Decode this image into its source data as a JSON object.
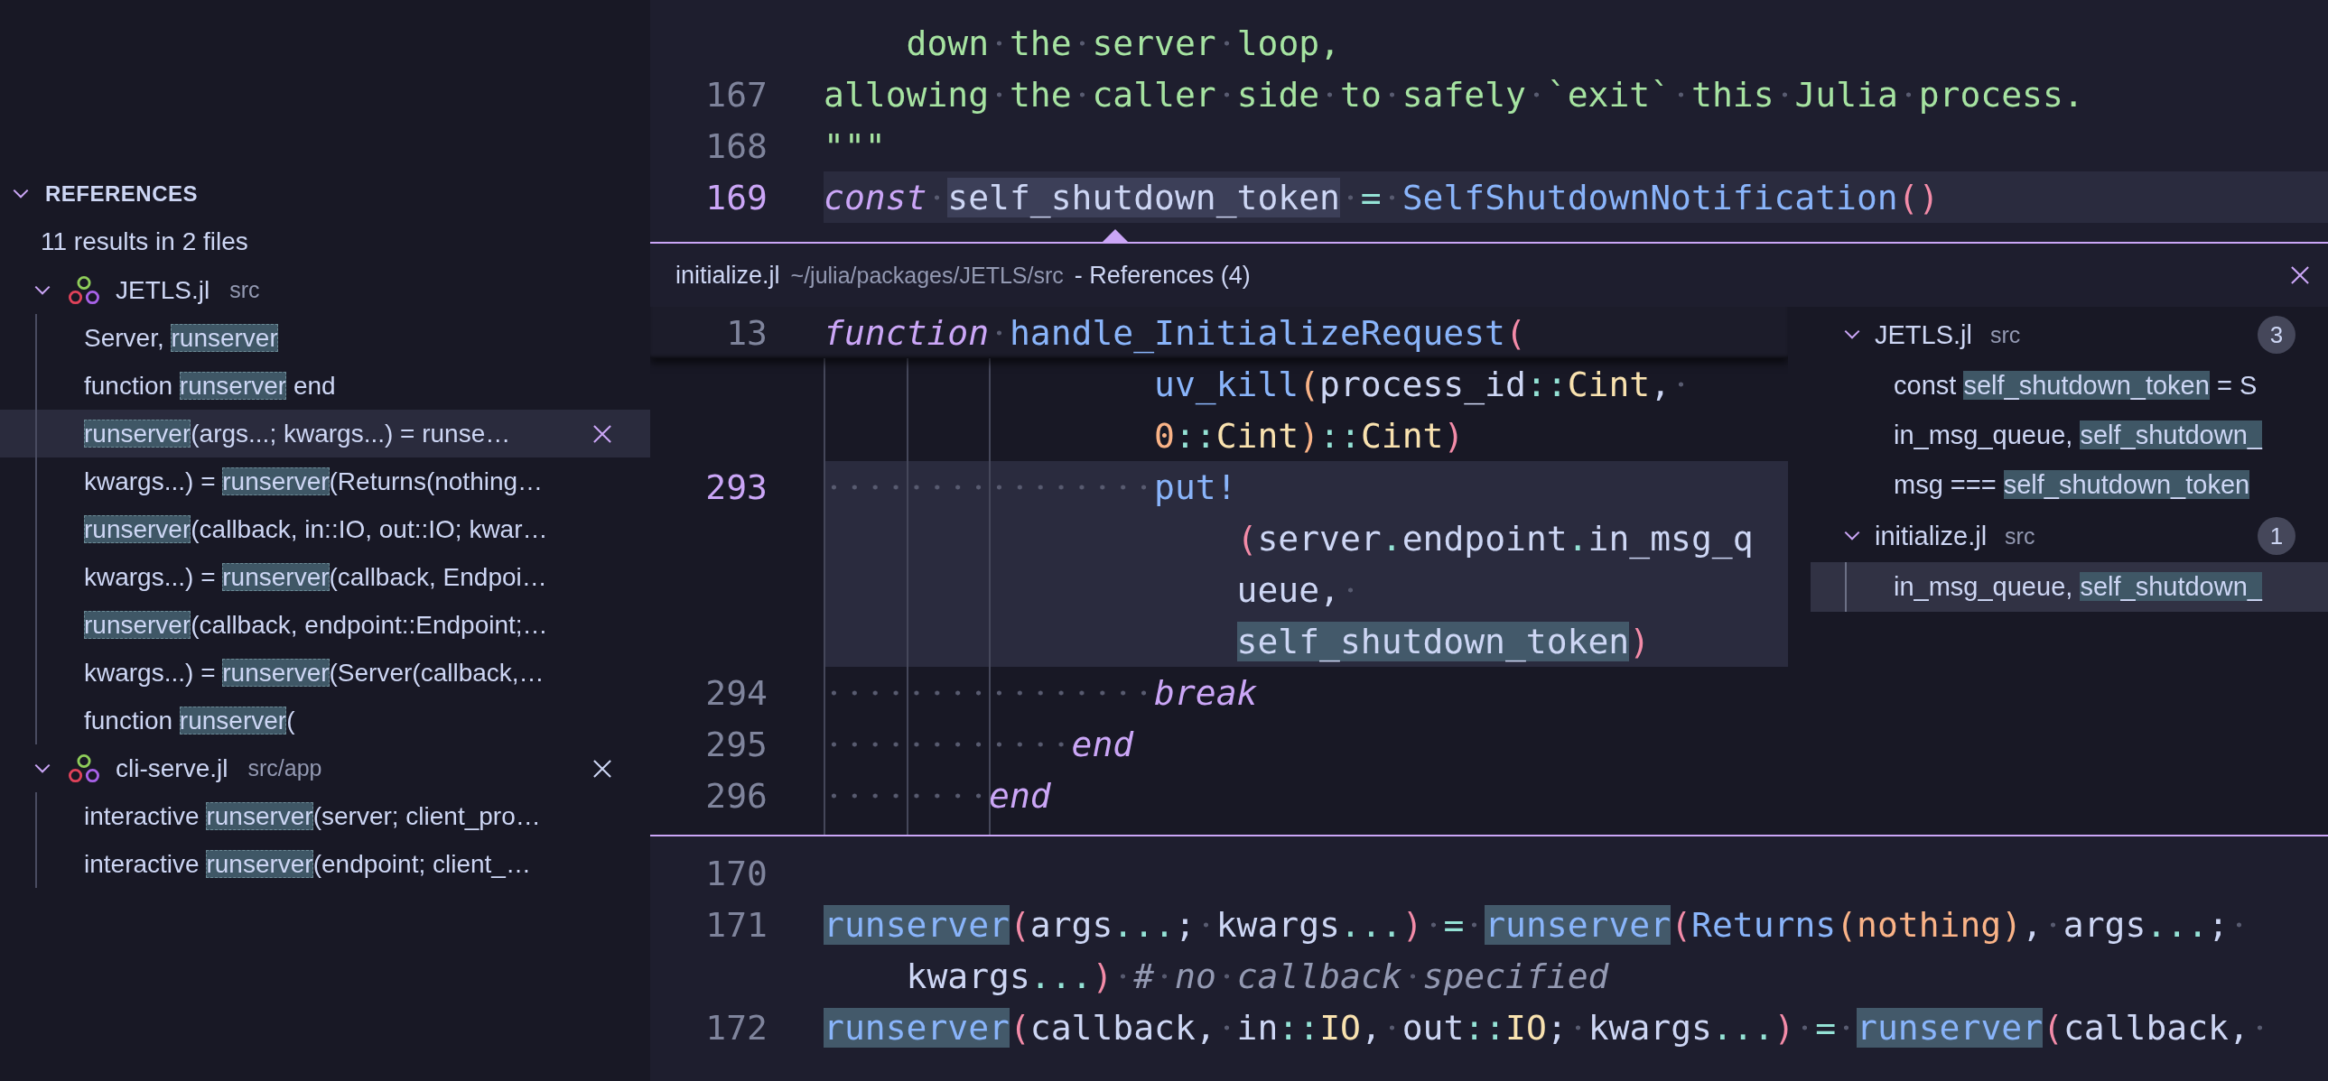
{
  "references": {
    "title": "REFERENCES",
    "expanded": true,
    "summary": "11 results in 2 files",
    "files": [
      {
        "name": "JETLS.jl",
        "path": "src",
        "expanded": true,
        "show_close": false,
        "results": [
          {
            "before": "Server, ",
            "match": "runserver",
            "selected": false
          },
          {
            "before": "function ",
            "match": "runserver",
            "after": " end",
            "selected": false
          },
          {
            "match": "runserver",
            "after": "(args...; kwargs...) = runse…",
            "selected": true
          },
          {
            "before": "kwargs...) = ",
            "match": "runserver",
            "after": "(Returns(nothing…",
            "selected": false
          },
          {
            "match": "runserver",
            "after": "(callback, in::IO, out::IO; kwar…",
            "selected": false
          },
          {
            "before": "kwargs...) = ",
            "match": "runserver",
            "after": "(callback, Endpoi…",
            "selected": false
          },
          {
            "match": "runserver",
            "after": "(callback, endpoint::Endpoint;…",
            "selected": false
          },
          {
            "before": "kwargs...) = ",
            "match": "runserver",
            "after": "(Server(callback,…",
            "selected": false
          },
          {
            "before": "function ",
            "match": "runserver",
            "after": "(",
            "selected": false
          }
        ]
      },
      {
        "name": "cli-serve.jl",
        "path": "src/app",
        "expanded": true,
        "show_close": true,
        "results": [
          {
            "before": "interactive ",
            "match": "runserver",
            "after": "(server; client_pro…",
            "selected": false
          },
          {
            "before": "interactive ",
            "match": "runserver",
            "after": "(endpoint; client_…",
            "selected": false
          }
        ]
      }
    ]
  },
  "top_editor": {
    "lines": [
      {
        "current": false,
        "rows": [
          {
            "spans": [
              {
                "kind": "str",
                "text": "    down the server loop,"
              }
            ]
          }
        ]
      },
      {
        "number": "167",
        "current": false,
        "rows": [
          {
            "spans": [
              {
                "kind": "str",
                "text": "allowing the caller side to safely `exit` this Julia process."
              }
            ]
          }
        ]
      },
      {
        "number": "168",
        "current": false,
        "rows": [
          {
            "spans": [
              {
                "kind": "str",
                "text": "\"\"\""
              }
            ]
          }
        ]
      },
      {
        "number": "169",
        "current": true,
        "rows": [
          {
            "spans": [
              {
                "kind": "kw",
                "text": "const "
              },
              {
                "kind": "plain",
                "text": "self_shutdown_token",
                "selected": true
              },
              {
                "kind": "op",
                "text": " = "
              },
              {
                "kind": "fn",
                "text": "SelfShutdownNotification"
              },
              {
                "kind": "paren",
                "text": "()"
              }
            ]
          }
        ]
      }
    ]
  },
  "peek": {
    "file": "initialize.jl",
    "path": "~/julia/packages/JETLS/src",
    "title": "- References (4)",
    "lines": [
      {
        "number": "13",
        "current": false,
        "sticky": true,
        "rows": [
          {
            "spans": [
              {
                "kind": "kw",
                "text": "function "
              },
              {
                "kind": "fn",
                "text": "handle_InitializeRequest"
              },
              {
                "kind": "paren",
                "text": "("
              }
            ]
          }
        ]
      },
      {
        "current": false,
        "sticky": false,
        "rows": [
          {
            "spans": [
              {
                "kind": "fn",
                "text": "                uv_kill"
              },
              {
                "kind": "num",
                "text": "("
              },
              {
                "kind": "plain",
                "text": "process_id"
              },
              {
                "kind": "op",
                "text": "::"
              },
              {
                "kind": "type",
                "text": "Cint"
              },
              {
                "kind": "plain",
                "text": ", "
              }
            ]
          },
          {
            "spans": [
              {
                "kind": "num",
                "text": "                0"
              },
              {
                "kind": "op",
                "text": "::"
              },
              {
                "kind": "type",
                "text": "Cint"
              },
              {
                "kind": "num",
                "text": ")"
              },
              {
                "kind": "op",
                "text": "::"
              },
              {
                "kind": "type",
                "text": "Cint"
              },
              {
                "kind": "paren",
                "text": ")"
              }
            ]
          }
        ]
      },
      {
        "number": "293",
        "current": true,
        "sticky": false,
        "rows": [
          {
            "spans": [
              {
                "kind": "fn",
                "text": "                put!"
              }
            ]
          },
          {
            "spans": [
              {
                "kind": "paren",
                "text": "                    ("
              },
              {
                "kind": "plain",
                "text": "server"
              },
              {
                "kind": "op",
                "text": "."
              },
              {
                "kind": "plain",
                "text": "endpoint"
              },
              {
                "kind": "op",
                "text": "."
              },
              {
                "kind": "plain",
                "text": "in_msg_q"
              }
            ]
          },
          {
            "spans": [
              {
                "kind": "plain",
                "text": "                    ueue, "
              }
            ]
          },
          {
            "spans": [
              {
                "kind": "plain",
                "text": "                    self_shutdown_token",
                "highlighted": true
              },
              {
                "kind": "paren",
                "text": ")"
              }
            ]
          }
        ]
      },
      {
        "number": "294",
        "current": false,
        "sticky": false,
        "rows": [
          {
            "spans": [
              {
                "kind": "kw",
                "text": "                break"
              }
            ]
          }
        ]
      },
      {
        "number": "295",
        "current": false,
        "sticky": false,
        "rows": [
          {
            "spans": [
              {
                "kind": "kw",
                "text": "            end"
              }
            ]
          }
        ]
      },
      {
        "number": "296",
        "current": false,
        "sticky": false,
        "rows": [
          {
            "spans": [
              {
                "kind": "kw",
                "text": "        end"
              }
            ]
          }
        ]
      }
    ],
    "groups": [
      {
        "name": "JETLS.jl",
        "path": "src",
        "count": "3",
        "expanded": true,
        "results": [
          {
            "before": "const ",
            "match": "self_shutdown_token",
            "after": " = S",
            "selected": false
          },
          {
            "before": "in_msg_queue, ",
            "match": "self_shutdown_",
            "selected": false
          },
          {
            "before": "msg === ",
            "match": "self_shutdown_token",
            "selected": false
          }
        ]
      },
      {
        "name": "initialize.jl",
        "path": "src",
        "count": "1",
        "expanded": true,
        "results": [
          {
            "before": "in_msg_queue, ",
            "match": "self_shutdown_",
            "selected": true
          }
        ]
      }
    ]
  },
  "bottom_editor": {
    "lines": [
      {
        "number": "170",
        "current": false
      },
      {
        "number": "171",
        "current": false,
        "rows": [
          {
            "spans": [
              {
                "kind": "fn",
                "text": "runserver",
                "highlighted": true
              },
              {
                "kind": "paren",
                "text": "("
              },
              {
                "kind": "plain",
                "text": "args"
              },
              {
                "kind": "op",
                "text": "..."
              },
              {
                "kind": "plain",
                "text": "; kwargs"
              },
              {
                "kind": "op",
                "text": "..."
              },
              {
                "kind": "paren",
                "text": ") "
              },
              {
                "kind": "op",
                "text": "= "
              },
              {
                "kind": "fn",
                "text": "runserver",
                "highlighted": true
              },
              {
                "kind": "paren",
                "text": "("
              },
              {
                "kind": "fn",
                "text": "Returns"
              },
              {
                "kind": "num",
                "text": "(nothing)"
              },
              {
                "kind": "plain",
                "text": ", args"
              },
              {
                "kind": "op",
                "text": "..."
              },
              {
                "kind": "plain",
                "text": "; "
              }
            ]
          },
          {
            "spans": [
              {
                "kind": "plain",
                "text": "    kwargs"
              },
              {
                "kind": "op",
                "text": "..."
              },
              {
                "kind": "paren",
                "text": ") "
              },
              {
                "kind": "comment",
                "text": "# no callback specified"
              }
            ]
          }
        ]
      },
      {
        "number": "172",
        "current": false,
        "rows": [
          {
            "spans": [
              {
                "kind": "fn",
                "text": "runserver",
                "highlighted": true
              },
              {
                "kind": "paren",
                "text": "("
              },
              {
                "kind": "plain",
                "text": "callback, in"
              },
              {
                "kind": "op",
                "text": "::"
              },
              {
                "kind": "type",
                "text": "IO"
              },
              {
                "kind": "plain",
                "text": ", out"
              },
              {
                "kind": "op",
                "text": "::"
              },
              {
                "kind": "type",
                "text": "IO"
              },
              {
                "kind": "plain",
                "text": "; kwargs"
              },
              {
                "kind": "op",
                "text": "..."
              },
              {
                "kind": "paren",
                "text": ") "
              },
              {
                "kind": "op",
                "text": "= "
              },
              {
                "kind": "fn",
                "text": "runserver",
                "highlighted": true
              },
              {
                "kind": "paren",
                "text": "("
              },
              {
                "kind": "plain",
                "text": "callback, "
              }
            ]
          }
        ]
      }
    ]
  }
}
